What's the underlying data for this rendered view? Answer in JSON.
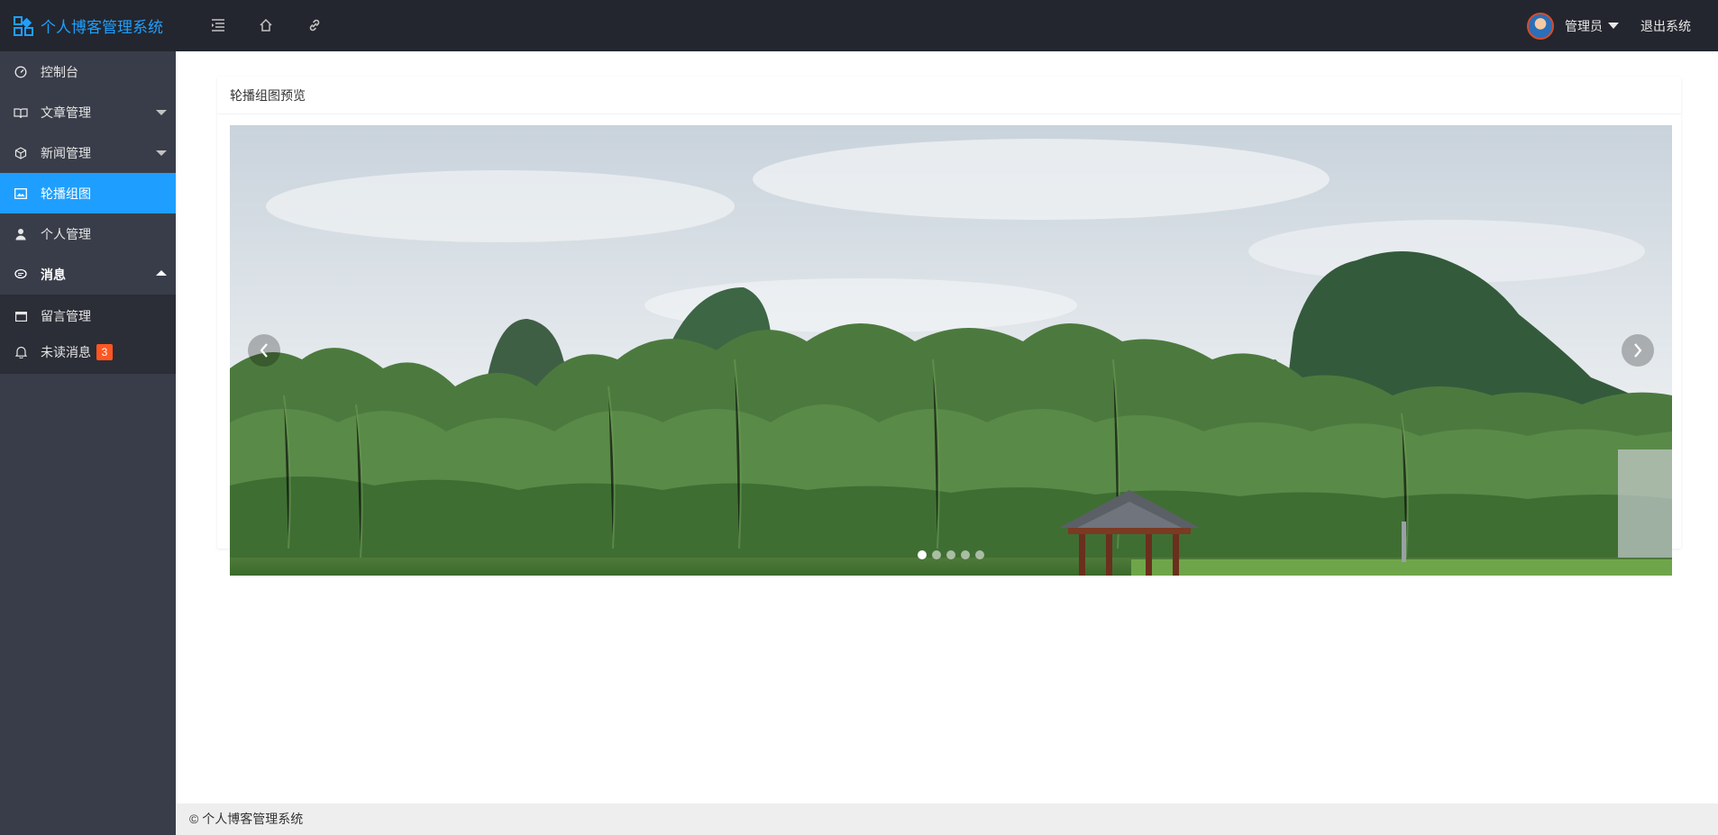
{
  "app": {
    "title": "个人博客管理系统"
  },
  "header": {
    "tools": [
      "menu-toggle-icon",
      "home-icon",
      "link-icon"
    ],
    "user": {
      "name": "管理员"
    },
    "logout_label": "退出系统"
  },
  "sidebar": {
    "items": [
      {
        "label": "控制台",
        "icon": "dashboard-icon"
      },
      {
        "label": "文章管理",
        "icon": "book-icon",
        "expandable": true
      },
      {
        "label": "新闻管理",
        "icon": "cube-icon",
        "expandable": true
      },
      {
        "label": "轮播组图",
        "icon": "image-icon",
        "active": true
      },
      {
        "label": "个人管理",
        "icon": "user-icon"
      },
      {
        "label": "消息",
        "icon": "chat-icon",
        "expanded": true
      }
    ],
    "sub_items": [
      {
        "label": "留言管理",
        "icon": "window-icon"
      },
      {
        "label": "未读消息",
        "icon": "bell-icon",
        "badge": "3"
      }
    ],
    "colors": {
      "bg": "#393d49",
      "active": "#1e9fff",
      "badge": "#ff5722"
    }
  },
  "main": {
    "card_title": "轮播组图预览",
    "carousel": {
      "slide_count": 5,
      "active_index": 0,
      "image": "karst-mountain-landscape"
    }
  },
  "footer": {
    "text": "© 个人博客管理系统"
  }
}
